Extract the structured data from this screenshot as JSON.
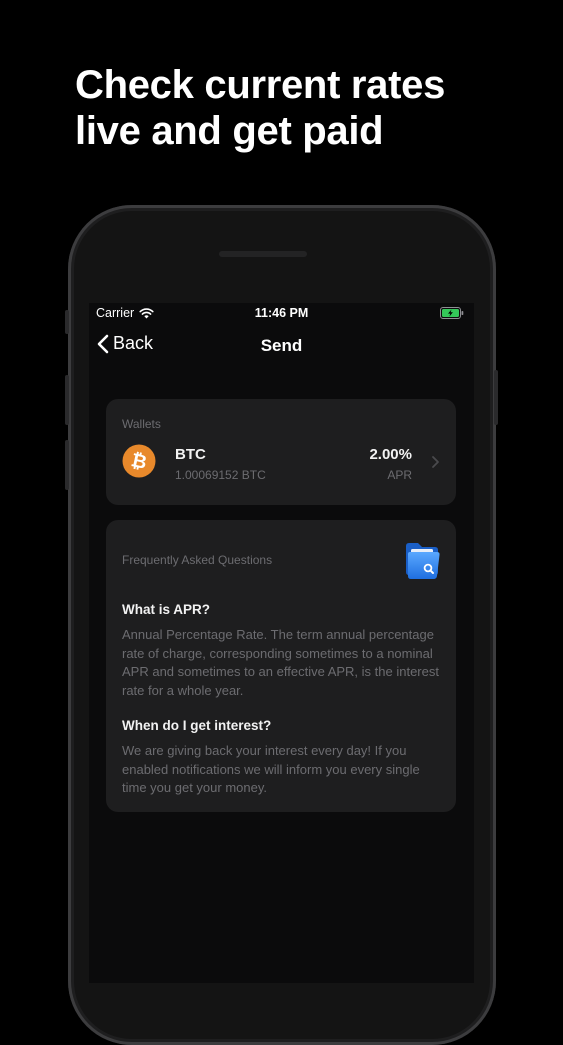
{
  "headline": {
    "line1": "Check current rates",
    "line2": "live and get paid"
  },
  "status_bar": {
    "carrier": "Carrier",
    "time": "11:46 PM"
  },
  "nav": {
    "back_label": "Back",
    "title": "Send"
  },
  "wallets": {
    "label": "Wallets",
    "items": [
      {
        "name": "BTC",
        "amount": "1.00069152 BTC",
        "rate": "2.00%",
        "rate_label": "APR",
        "icon": "bitcoin-icon",
        "color": "#E8892B"
      }
    ]
  },
  "faq": {
    "label": "Frequently Asked Questions",
    "icon": "folder-search-icon",
    "items": [
      {
        "question": "What is APR?",
        "answer": "Annual Percentage Rate. The term annual percentage rate of charge, corresponding sometimes to a nominal APR and sometimes to an effective APR, is the interest rate for a whole year."
      },
      {
        "question": "When do I get interest?",
        "answer": "We are giving back your interest every day! If you enabled notifications we will inform you every single time you get your money."
      }
    ]
  },
  "colors": {
    "background": "#000000",
    "card": "#1E1E1F",
    "muted_text": "#6C6C70",
    "battery": "#34C759"
  }
}
